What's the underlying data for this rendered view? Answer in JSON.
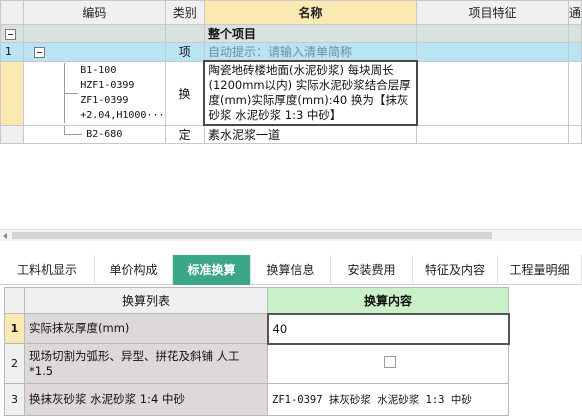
{
  "grid": {
    "columns": {
      "code": "编码",
      "type": "类别",
      "name": "名称",
      "feature": "项目特征",
      "next": "通"
    },
    "root": {
      "name": "整个项目"
    },
    "item": {
      "row": "1",
      "type": "项",
      "name": "自动提示：请输入清单简称"
    },
    "sub1": {
      "codes": [
        "B1-100",
        "HZF1-0399",
        "ZF1-0399",
        "+2.04,H1000···"
      ],
      "type": "换",
      "name": "陶瓷地砖楼地面(水泥砂浆) 每块周长(1200mm以内) 实际水泥砂浆结合层厚度(mm)实际厚度(mm):40 换为【抹灰砂浆 水泥砂浆 1:3 中砂】"
    },
    "sub2": {
      "code": "B2-680",
      "type": "定",
      "name": "素水泥浆一道"
    }
  },
  "tabs": [
    "工料机显示",
    "单价构成",
    "标准换算",
    "换算信息",
    "安装费用",
    "特征及内容",
    "工程量明细"
  ],
  "active_tab": "标准换算",
  "conversion": {
    "headers": {
      "list": "换算列表",
      "content": "换算内容"
    },
    "rows": [
      {
        "num": "1",
        "label": "实际抹灰厚度(mm)",
        "value": "40"
      },
      {
        "num": "2",
        "label": "现场切割为弧形、异型、拼花及斜铺 人工*1.5",
        "value": ""
      },
      {
        "num": "3",
        "label": "换抹灰砂浆 水泥砂浆 1:4 中砂",
        "value": "ZF1-0397  抹灰砂浆 水泥砂浆 1:3 中砂"
      }
    ]
  }
}
